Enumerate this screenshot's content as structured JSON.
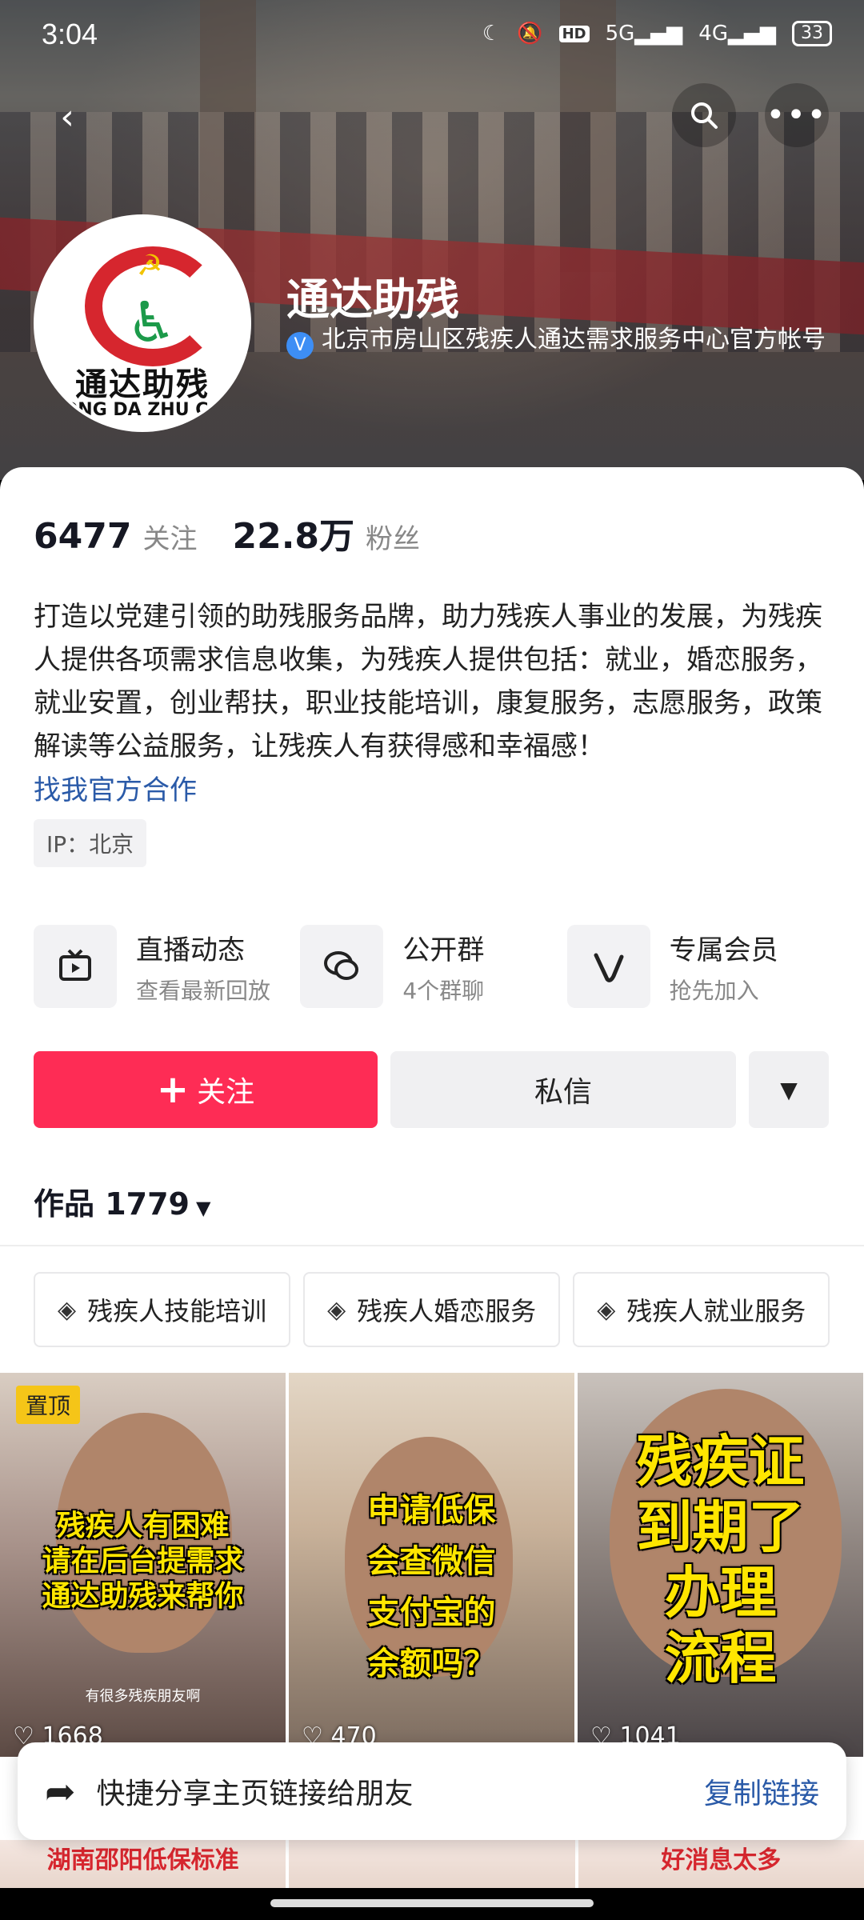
{
  "status_bar": {
    "time": "3:04",
    "network_5g": "5G",
    "network_4g": "4G",
    "battery": "33"
  },
  "profile": {
    "name": "通达助残",
    "logo_text": "通达助残",
    "logo_subtext": "ONG DA ZHU CA",
    "verify_text": "北京市房山区残疾人通达需求服务中心官方帐号",
    "following_count": "6477",
    "following_label": "关注",
    "followers_count": "22.8万",
    "followers_label": "粉丝",
    "bio": "打造以党建引领的助残服务品牌，助力残疾人事业的发展，为残疾人提供各项需求信息收集，为残疾人提供包括：就业，婚恋服务，就业安置，创业帮扶，职业技能培训，康复服务，志愿服务，政策解读等公益服务，让残疾人有获得感和幸福感！",
    "coop_link": "找我官方合作",
    "ip": "IP：北京"
  },
  "features": [
    {
      "title": "直播动态",
      "subtitle": "查看最新回放",
      "icon": "tv-icon"
    },
    {
      "title": "公开群",
      "subtitle": "4个群聊",
      "icon": "chat-icon"
    },
    {
      "title": "专属会员",
      "subtitle": "抢先加入",
      "icon": "v-icon"
    }
  ],
  "actions": {
    "follow": "关注",
    "message": "私信"
  },
  "works": {
    "label": "作品 1779"
  },
  "chips": [
    "残疾人技能培训",
    "残疾人婚恋服务",
    "残疾人就业服务"
  ],
  "videos": [
    {
      "pin": "置顶",
      "title_line1": "残疾人有困难",
      "title_line2": "请在后台提需求",
      "title_line3": "通达助残来帮你",
      "subtitle": "有很多残疾朋友啊",
      "likes": "1668"
    },
    {
      "title_line1": "申请低保",
      "title_line2": "会查微信",
      "title_line3": "支付宝的",
      "title_line4": "余额吗？",
      "likes": "470"
    },
    {
      "title_line1": "残疾证",
      "title_line2": "到期了",
      "title_line3": "办理",
      "title_line4": "流程",
      "likes": "1041"
    }
  ],
  "share": {
    "text": "快捷分享主页链接给朋友",
    "copy": "复制链接"
  },
  "partial_row": [
    "湖南邵阳低保标准",
    "",
    "好消息太多"
  ]
}
